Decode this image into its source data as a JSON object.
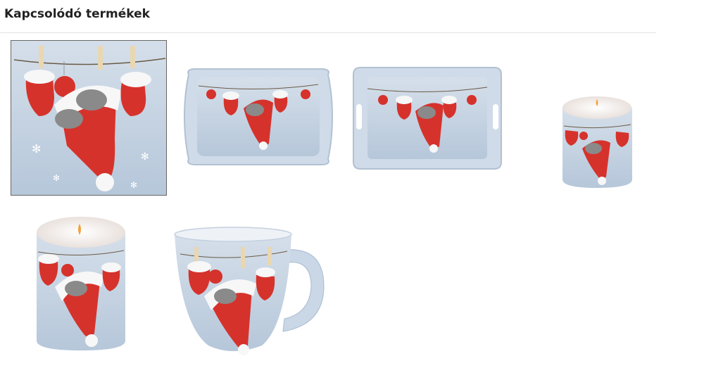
{
  "section": {
    "title": "Kapcsolódó termékek"
  },
  "products": [
    {
      "kind": "napkin",
      "icon": "napkin-image"
    },
    {
      "kind": "small-tray",
      "icon": "tray-image"
    },
    {
      "kind": "large-tray",
      "icon": "tray-image"
    },
    {
      "kind": "small-candle",
      "icon": "candle-image"
    },
    {
      "kind": "large-candle",
      "icon": "candle-image"
    },
    {
      "kind": "mug",
      "icon": "mug-image"
    }
  ],
  "colors": {
    "background_blue": "#bfcfe0",
    "hat_red": "#d6322c",
    "fur_white": "#f7f7f7",
    "clothespin": "#e9d7b1",
    "cat": "#8a8a8a"
  }
}
